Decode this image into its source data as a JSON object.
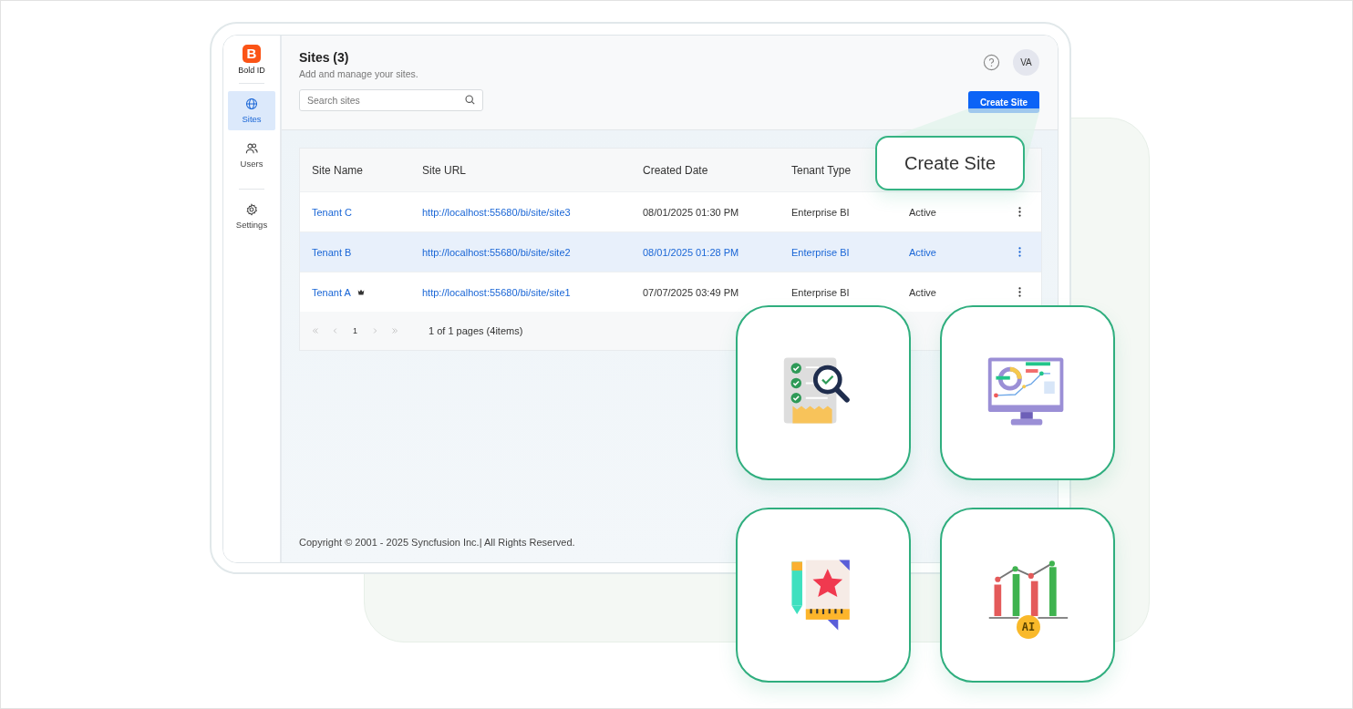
{
  "sidebar": {
    "logo": "B",
    "brand": "Bold ID",
    "items": [
      {
        "label": "Sites",
        "kind": "globe",
        "selected": true
      },
      {
        "label": "Users",
        "kind": "users",
        "selected": false
      },
      {
        "label": "Settings",
        "kind": "gear",
        "selected": false
      }
    ]
  },
  "header": {
    "title": "Sites (3)",
    "subtitle": "Add and manage your sites.",
    "search": {
      "placeholder": "Search sites"
    },
    "avatar": "VA",
    "button": "Create Site"
  },
  "table": {
    "columns": [
      "Site Name",
      "Site URL",
      "Created Date",
      "Tenant Type"
    ],
    "rows": [
      {
        "name": "Tenant C",
        "url": "http://localhost:55680/bi/site/site3",
        "created": "08/01/2025 01:30 PM",
        "type": "Enterprise BI",
        "status": "Active",
        "selected": false,
        "flagged": false
      },
      {
        "name": "Tenant B",
        "url": "http://localhost:55680/bi/site/site2",
        "created": "08/01/2025 01:28 PM",
        "type": "Enterprise BI",
        "status": "Active",
        "selected": true,
        "flagged": false
      },
      {
        "name": "Tenant A",
        "url": "http://localhost:55680/bi/site/site1",
        "created": "07/07/2025 03:49 PM",
        "type": "Enterprise BI",
        "status": "Active",
        "selected": false,
        "flagged": true
      }
    ]
  },
  "pager": {
    "pages": [
      "1"
    ],
    "summary": "1 of 1 pages (4items)"
  },
  "footer": "Copyright © 2001 - 2025 Syncfusion Inc.| All Rights Reserved.",
  "callout": "Create Site",
  "cards": [
    {
      "kind": "checklist"
    },
    {
      "kind": "monitor"
    },
    {
      "kind": "design"
    },
    {
      "kind": "ai_chart",
      "badge": "AI"
    }
  ]
}
